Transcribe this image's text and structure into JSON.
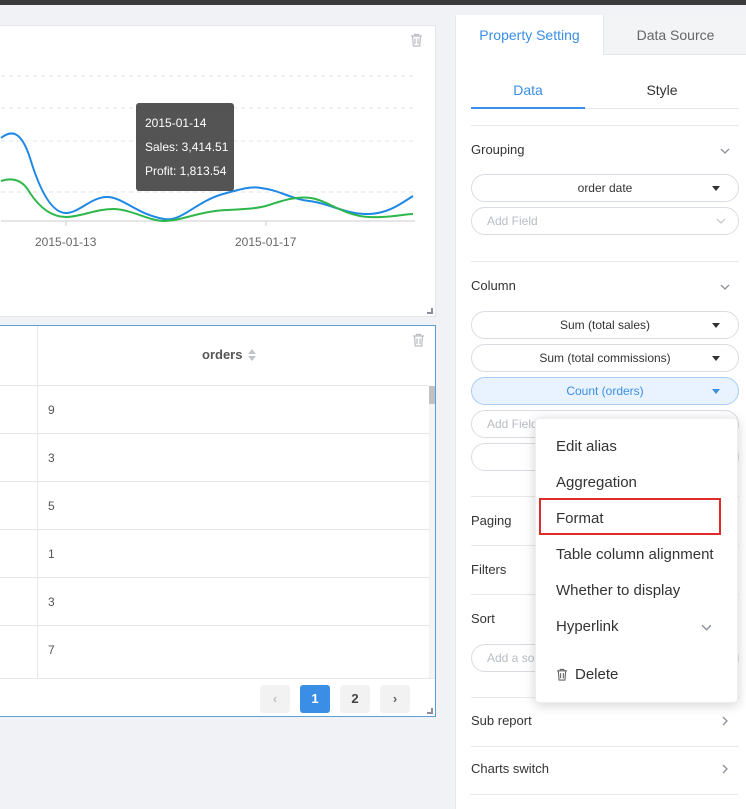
{
  "chart": {
    "x_ticks": [
      "2015-01-13",
      "2015-01-17"
    ],
    "tooltip": {
      "date": "2015-01-14",
      "sales": "Sales: 3,414.51",
      "profit": "Profit: 1,813.54"
    },
    "colors": {
      "sales": "#1e88e5",
      "profit": "#2eb84b"
    }
  },
  "table": {
    "column_header": "orders",
    "rows": [
      "9",
      "3",
      "5",
      "1",
      "3",
      "7"
    ],
    "pager": {
      "prev": "‹",
      "pages": [
        "1",
        "2"
      ],
      "current": "1",
      "next": "›"
    }
  },
  "panel": {
    "tabs": [
      "Property Setting",
      "Data Source"
    ],
    "subtabs": [
      "Data",
      "Style"
    ],
    "grouping": {
      "title": "Grouping",
      "field": "order date",
      "add_placeholder": "Add Field"
    },
    "column": {
      "title": "Column",
      "fields": [
        "Sum (total sales)",
        "Sum (total commissions)",
        "Count (orders)"
      ],
      "add_placeholder": "Add Field"
    },
    "paging": "Paging",
    "filters": "Filters",
    "sort": {
      "title": "Sort",
      "placeholder": "Add a sort"
    },
    "sub_report": "Sub report",
    "charts_switch": "Charts switch"
  },
  "context_menu": {
    "items": [
      "Edit alias",
      "Aggregation",
      "Format",
      "Table column alignment",
      "Whether to display",
      "Hyperlink"
    ],
    "delete": "Delete",
    "highlighted": "Format"
  },
  "accent_color": "#3a8ee6",
  "highlight_color": "#e02b2b"
}
